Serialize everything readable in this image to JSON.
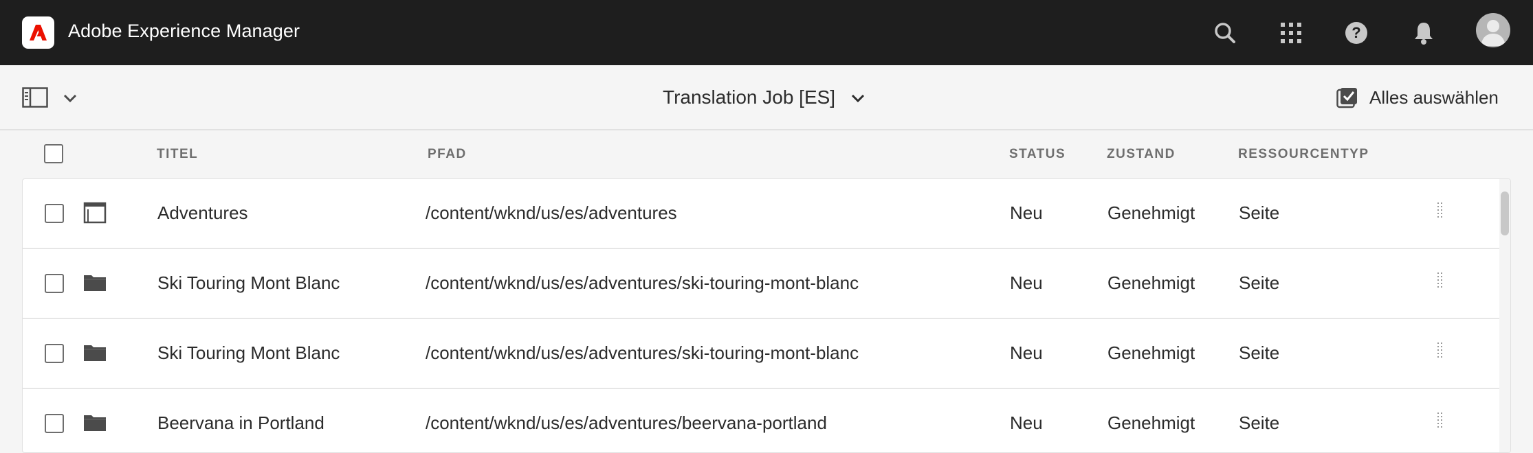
{
  "shell": {
    "app_title": "Adobe Experience Manager",
    "icons": [
      "search-icon",
      "apps-grid-icon",
      "help-icon",
      "notifications-bell-icon",
      "user-avatar-icon"
    ]
  },
  "actionbar": {
    "job_title": "Translation Job [ES]",
    "select_all_label": "Alles auswählen"
  },
  "table": {
    "columns": {
      "title": "TITEL",
      "path": "PFAD",
      "status": "STATUS",
      "state": "ZUSTAND",
      "type": "RESSOURCENTYP"
    },
    "rows": [
      {
        "icon": "page-icon",
        "title": "Adventures",
        "path": "/content/wknd/us/es/adventures",
        "status": "Neu",
        "state": "Genehmigt",
        "type": "Seite"
      },
      {
        "icon": "folder-icon",
        "title": "Ski Touring Mont Blanc",
        "path": "/content/wknd/us/es/adventures/ski-touring-mont-blanc",
        "status": "Neu",
        "state": "Genehmigt",
        "type": "Seite"
      },
      {
        "icon": "folder-icon",
        "title": "Ski Touring Mont Blanc",
        "path": "/content/wknd/us/es/adventures/ski-touring-mont-blanc",
        "status": "Neu",
        "state": "Genehmigt",
        "type": "Seite"
      },
      {
        "icon": "folder-icon",
        "title": "Beervana in Portland",
        "path": "/content/wknd/us/es/adventures/beervana-portland",
        "status": "Neu",
        "state": "Genehmigt",
        "type": "Seite"
      }
    ]
  },
  "colors": {
    "shell_bg": "#1e1e1e",
    "adobe_red": "#eb1000",
    "page_bg": "#f5f5f5",
    "text": "#2c2c2c",
    "header_text": "#6e6e6e"
  }
}
